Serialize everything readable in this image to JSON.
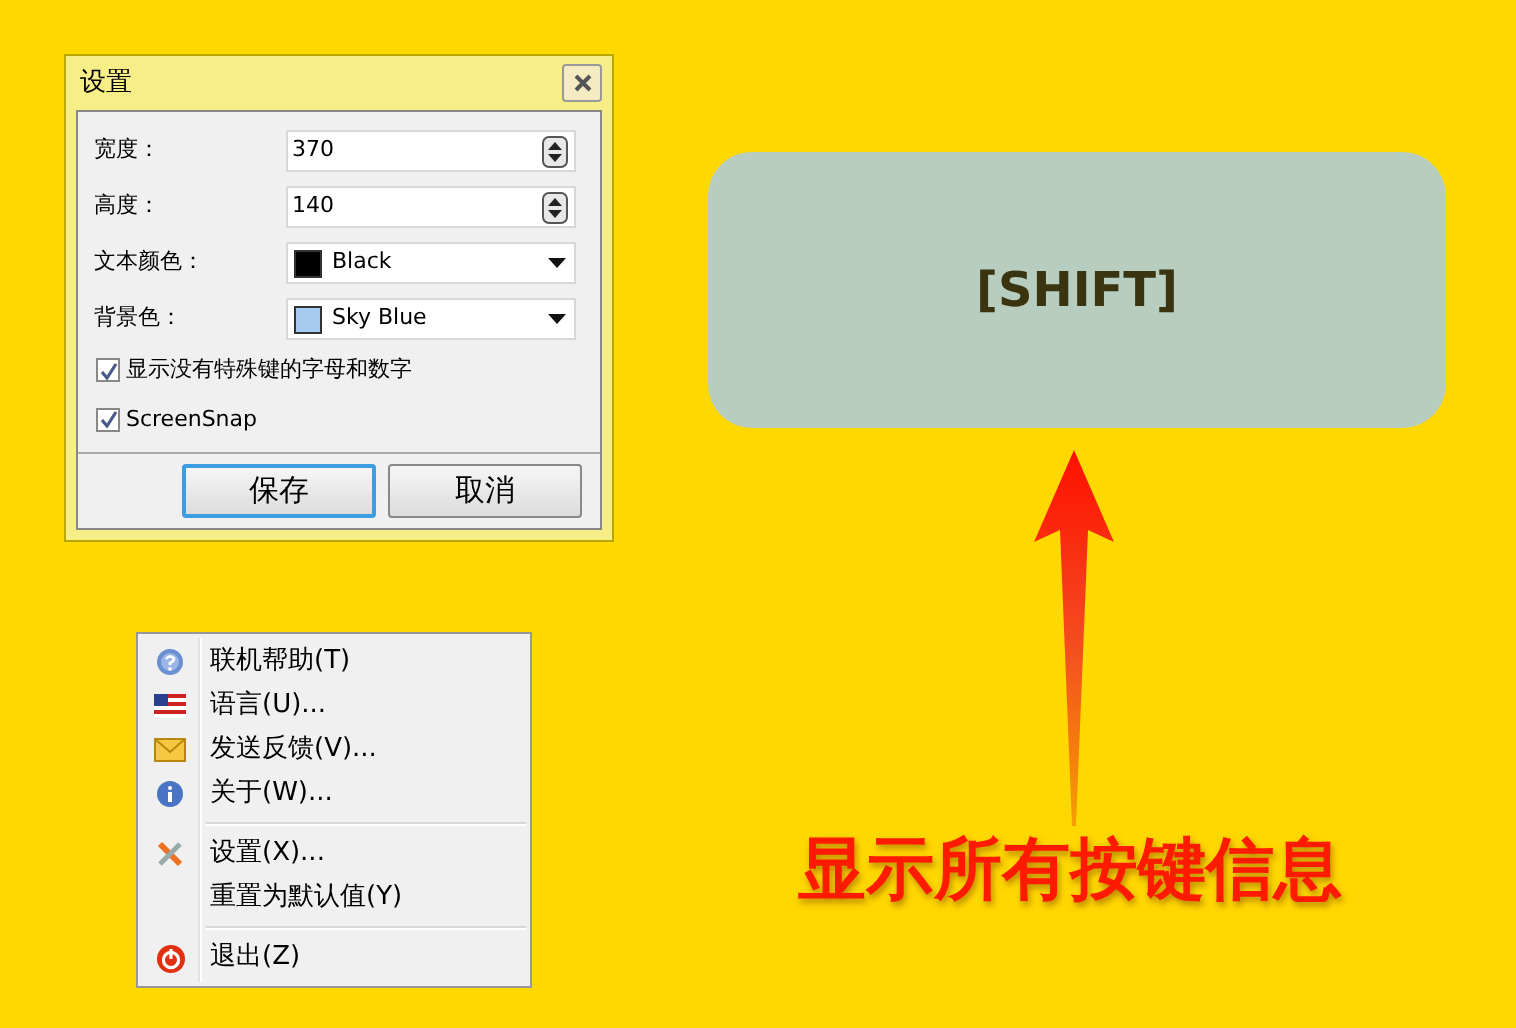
{
  "settings_dialog": {
    "title": "设置",
    "fields": [
      {
        "kind": "spin",
        "label": "宽度：",
        "value": "370"
      },
      {
        "kind": "spin",
        "label": "高度：",
        "value": "140"
      },
      {
        "kind": "color",
        "label": "文本颜色：",
        "value": "Black",
        "color": "#000000"
      },
      {
        "kind": "color",
        "label": "背景色：",
        "value": "Sky Blue",
        "color": "#a6caf0"
      }
    ],
    "checkboxes": [
      {
        "label": "显示没有特殊键的字母和数字",
        "checked": true
      },
      {
        "label": "ScreenSnap",
        "checked": true
      }
    ],
    "buttons": [
      {
        "label": "保存",
        "selected": true
      },
      {
        "label": "取消",
        "selected": false
      }
    ]
  },
  "context_menu": {
    "items": [
      {
        "kind": "item",
        "label": "联机帮助(T)"
      },
      {
        "kind": "item",
        "label": "语言(U)..."
      },
      {
        "kind": "item",
        "label": "发送反馈(V)..."
      },
      {
        "kind": "item",
        "label": "关于(W)..."
      },
      {
        "kind": "separator"
      },
      {
        "kind": "item",
        "label": "设置(X)..."
      },
      {
        "kind": "item",
        "label": "重置为默认值(Y)"
      },
      {
        "kind": "separator"
      },
      {
        "kind": "item",
        "label": "退出(Z)"
      }
    ]
  },
  "key_display": {
    "text": "[SHIFT]"
  },
  "caption": "显示所有按键信息"
}
